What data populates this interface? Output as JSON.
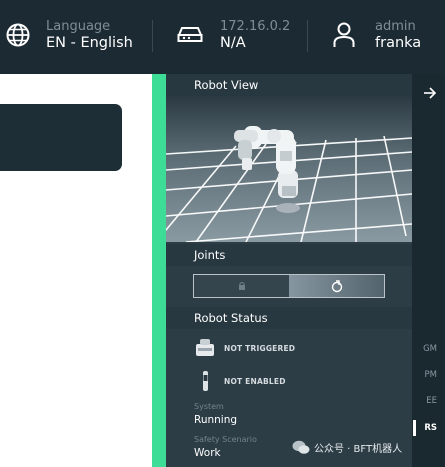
{
  "header": {
    "language": {
      "label": "Language",
      "value": "EN - English",
      "icon": "globe-icon"
    },
    "network": {
      "label": "172.16.0.2",
      "value": "N/A",
      "icon": "network-device-icon"
    },
    "user": {
      "label": "admin",
      "value": "franka",
      "icon": "user-icon"
    }
  },
  "panel": {
    "robot_view_title": "Robot View",
    "joints_title": "Joints",
    "robot_status_title": "Robot Status",
    "status_items": [
      {
        "icon": "emergency-stop-icon",
        "label": "NOT TRIGGERED"
      },
      {
        "icon": "enabling-device-icon",
        "label": "NOT ENABLED"
      }
    ],
    "system_label": "System",
    "system_value": "Running",
    "safety_label": "Safety Scenario",
    "safety_value": "Work"
  },
  "sidebar": {
    "collapse_icon": "arrow-right-icon",
    "items": [
      "GM",
      "PM",
      "EE",
      "RS"
    ],
    "active_item": "RS"
  },
  "watermark": {
    "text": "公众号 · BFT机器人"
  },
  "colors": {
    "header_bg": "#1c2a33",
    "accent_green": "#3ddc97",
    "panel_bg": "#2c3d46",
    "sidebar_bg": "#1a2830"
  }
}
